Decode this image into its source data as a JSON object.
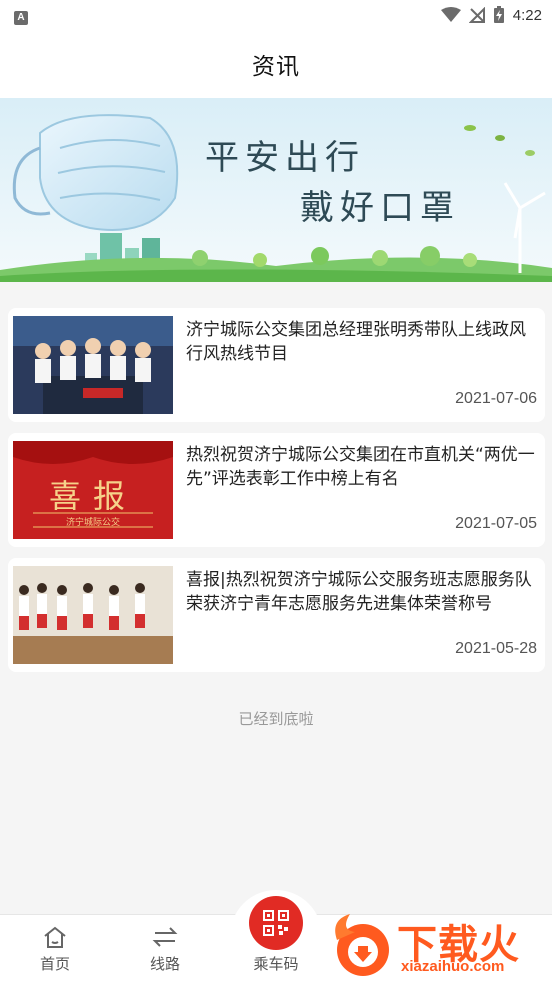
{
  "status_bar": {
    "time": "4:22",
    "app_badge": "A"
  },
  "header": {
    "title": "资讯"
  },
  "banner": {
    "line1": "平安出行",
    "line2": "戴好口罩"
  },
  "news": [
    {
      "title": "济宁城际公交集团总经理张明秀带队上线政风行风热线节目",
      "date": "2021-07-06"
    },
    {
      "title": "热烈祝贺济宁城际公交集团在市直机关“两优一先”评选表彰工作中榜上有名",
      "date": "2021-07-05",
      "thumb_title": "喜报",
      "thumb_sub": "济宁城际公交"
    },
    {
      "title": "喜报|热烈祝贺济宁城际公交服务班志愿服务队荣获济宁青年志愿服务先进集体荣誉称号",
      "date": "2021-05-28"
    }
  ],
  "list_end_text": "已经到底啦",
  "tab_bar": {
    "home": "首页",
    "route": "线路",
    "qr": "乘车码"
  },
  "watermark": {
    "text": "下载火",
    "url": "xiazaihuo.com"
  },
  "colors": {
    "accent": "#e12b24",
    "watermark": "#ff5a1f"
  }
}
